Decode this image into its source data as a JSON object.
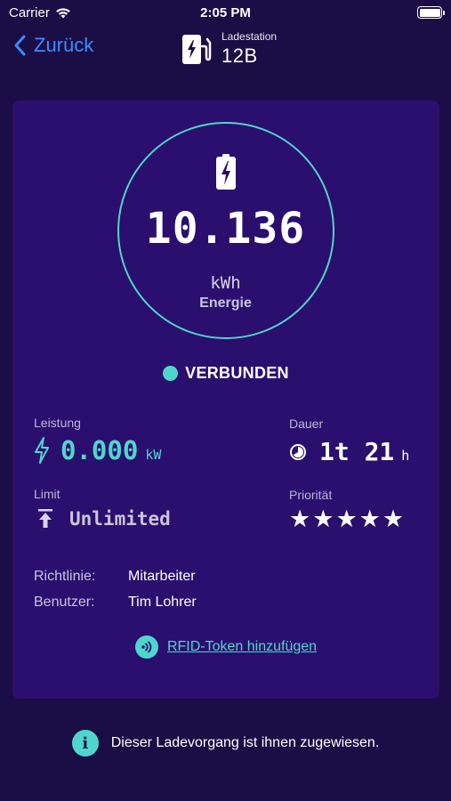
{
  "status_bar": {
    "carrier": "Carrier",
    "time": "2:05 PM"
  },
  "nav": {
    "back_label": "Zurück",
    "station_caption": "Ladestation",
    "station_name": "12B"
  },
  "energy": {
    "value": "10.136",
    "unit": "kWh",
    "label": "Energie"
  },
  "connection": {
    "status": "VERBUNDEN"
  },
  "metrics": {
    "power": {
      "caption": "Leistung",
      "value": "0.000",
      "unit": "kW"
    },
    "duration": {
      "caption": "Dauer",
      "value": "1t 21",
      "unit": "h"
    },
    "limit": {
      "caption": "Limit",
      "value": "Unlimited"
    },
    "priority": {
      "caption": "Priorität",
      "stars": 5,
      "max_stars": 5
    }
  },
  "details": {
    "policy_label": "Richtlinie:",
    "policy_value": "Mitarbeiter",
    "user_label": "Benutzer:",
    "user_value": "Tim Lohrer"
  },
  "rfid": {
    "link_label": "RFID-Token hinzufügen"
  },
  "notice": {
    "text": "Dieser Ladevorgang ist ihnen zugewiesen."
  },
  "colors": {
    "background": "#1b0d45",
    "card": "#2a0f6e",
    "accent": "#4fd6cc",
    "link_blue": "#3a8dff"
  }
}
